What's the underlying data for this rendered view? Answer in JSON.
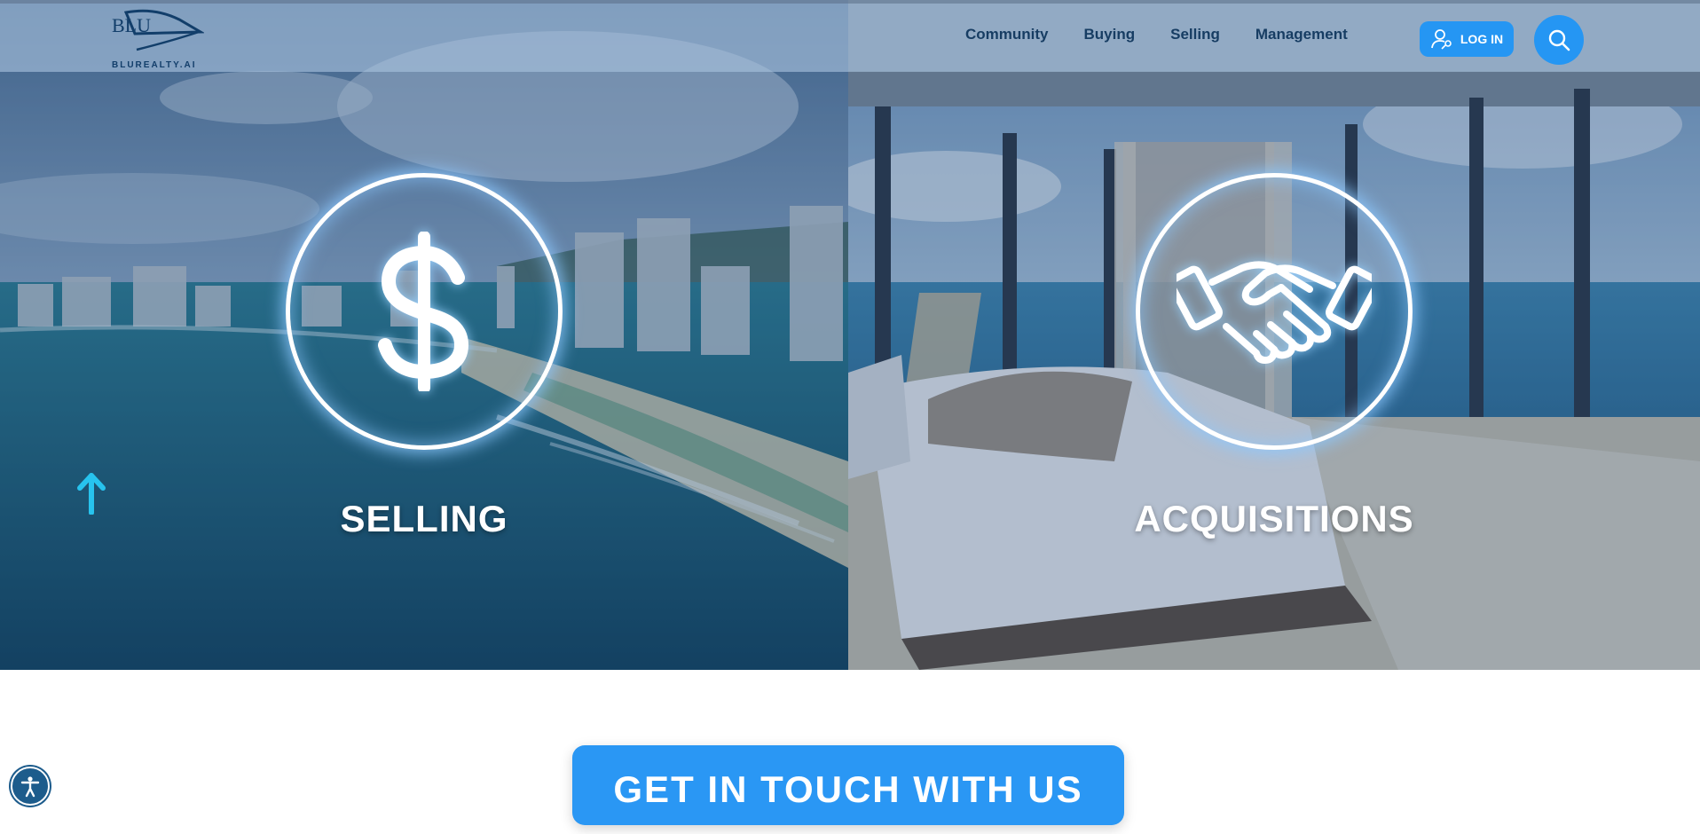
{
  "brand": {
    "logo_mark": "BLU",
    "name": "BLUREALTY.AI"
  },
  "nav": {
    "items": [
      {
        "label": "Community"
      },
      {
        "label": "Buying"
      },
      {
        "label": "Selling"
      },
      {
        "label": "Management"
      }
    ],
    "login_label": "LOG IN",
    "login_icon": "user-key-icon",
    "search_icon": "search-icon"
  },
  "hero": {
    "panels": [
      {
        "title": "SELLING",
        "icon": "dollar-icon"
      },
      {
        "title": "ACQUISITIONS",
        "icon": "handshake-icon"
      }
    ]
  },
  "cta": {
    "label": "GET IN TOUCH WITH US"
  },
  "widgets": {
    "back_to_top_icon": "arrow-up-icon",
    "accessibility_icon": "accessibility-icon"
  },
  "colors": {
    "accent_blue": "#2596f3",
    "header_overlay": "#aac3de",
    "nav_text": "#173d63",
    "arrow_cyan": "#27c3ee"
  }
}
